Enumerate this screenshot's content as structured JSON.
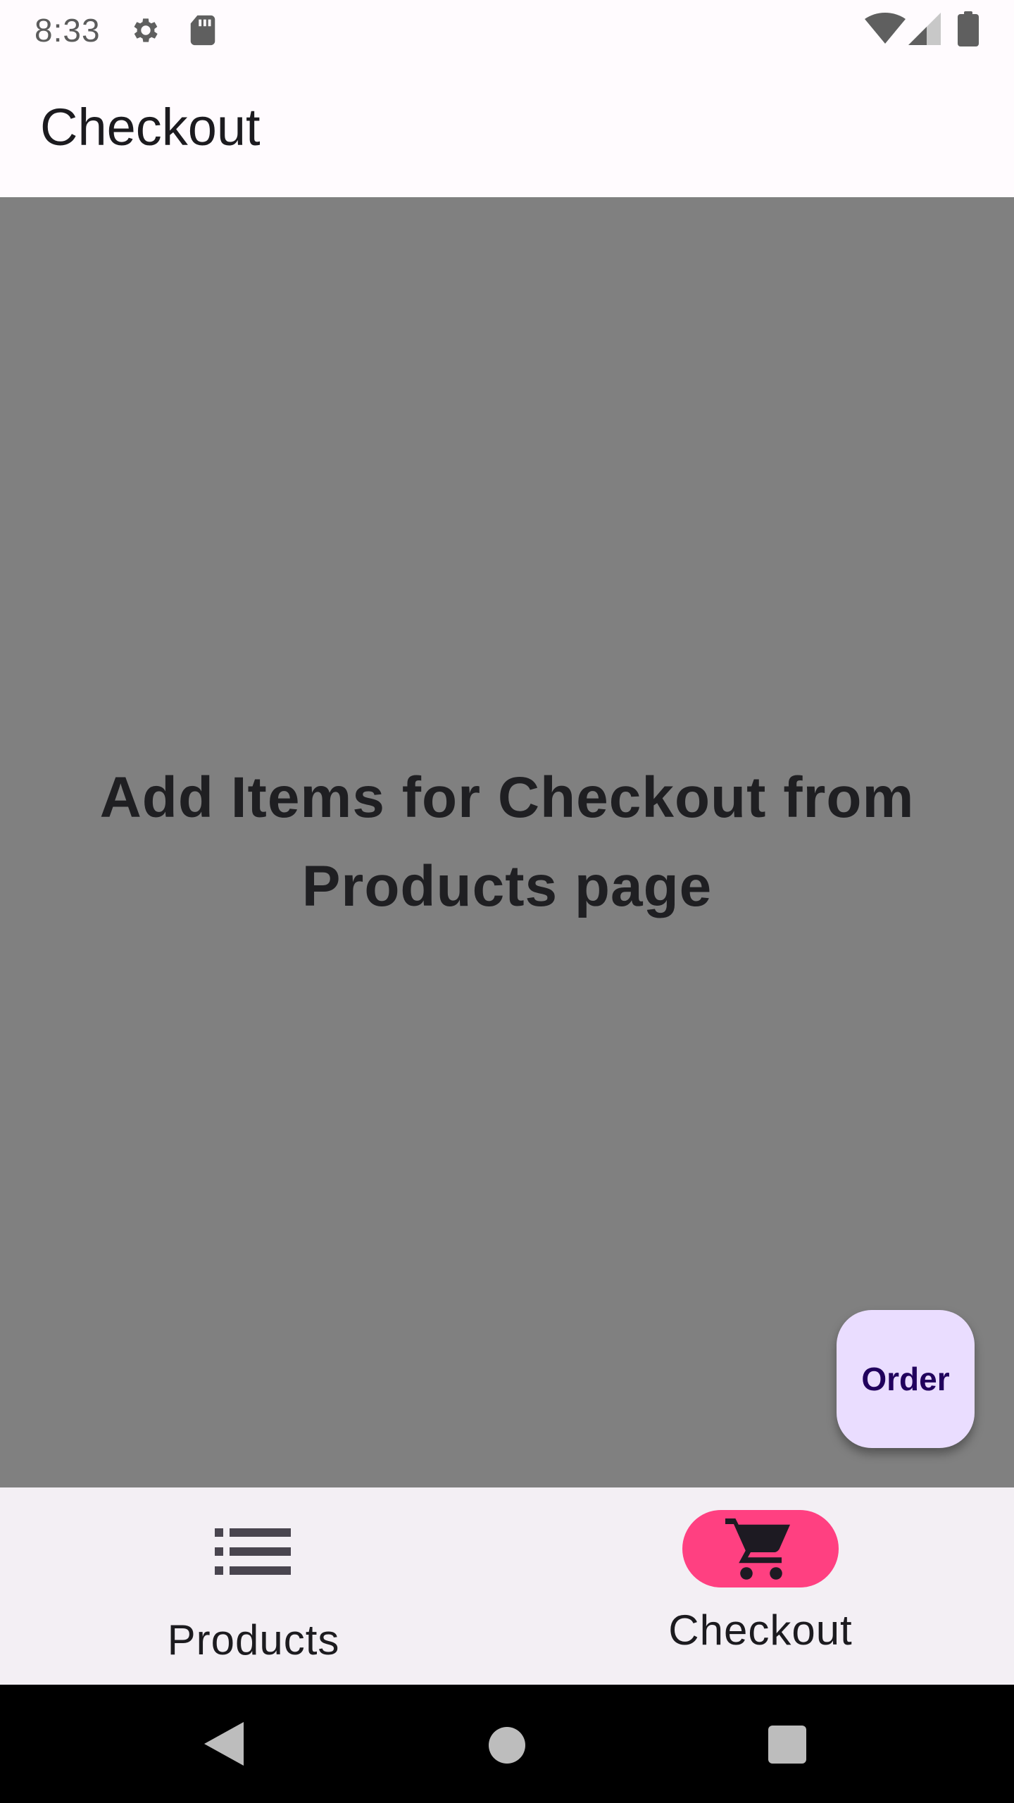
{
  "status_bar": {
    "time": "8:33",
    "icons": [
      "gear-icon",
      "sd-card-icon",
      "wifi-icon",
      "signal-icon",
      "battery-icon"
    ]
  },
  "app_bar": {
    "title": "Checkout"
  },
  "main": {
    "empty_message": "Add Items for Checkout from Products page",
    "fab_label": "Order"
  },
  "bottom_nav": {
    "items": [
      {
        "label": "Products",
        "icon": "list-icon",
        "selected": false
      },
      {
        "label": "Checkout",
        "icon": "cart-icon",
        "selected": true
      }
    ]
  },
  "system_nav": {
    "buttons": [
      "back-icon",
      "home-icon",
      "recents-icon"
    ]
  },
  "colors": {
    "background": "#fffbfe",
    "content_scrim": "#808080",
    "fab_bg": "#eaddff",
    "fab_text": "#21005d",
    "nav_bg": "#f3eff4",
    "nav_indicator": "#ff4081",
    "text_primary": "#1c1b1f"
  }
}
